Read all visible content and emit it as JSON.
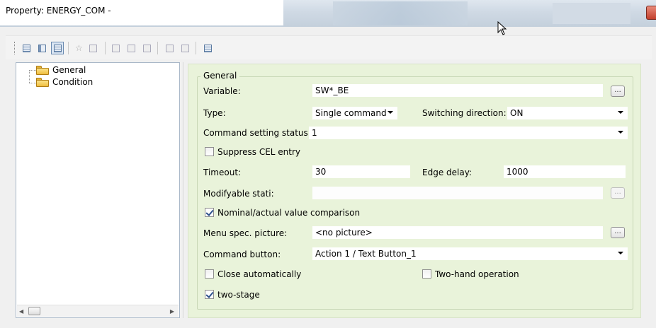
{
  "window": {
    "title": "Property: ENERGY_COM -"
  },
  "toolbar": {
    "buttons": [
      "view-list-icon",
      "view-details-icon",
      "view-properties-icon",
      "favorite-icon",
      "copy-icon",
      "grid-icon",
      "field-icon",
      "field2-icon",
      "layout-icon",
      "align-icon",
      "table-icon"
    ]
  },
  "tree": {
    "items": [
      {
        "label": "General",
        "icon": "folder-icon"
      },
      {
        "label": "Condition",
        "icon": "folder-icon"
      }
    ]
  },
  "general": {
    "group_title": "General",
    "variable_label": "Variable:",
    "variable_value": "SW*_BE",
    "type_label": "Type:",
    "type_value": "Single command",
    "switching_direction_label": "Switching direction:",
    "switching_direction_value": "ON",
    "command_setting_status_label": "Command setting status:",
    "command_setting_status_value": "1",
    "suppress_cel_label": "Suppress CEL entry",
    "suppress_cel_checked": false,
    "timeout_label": "Timeout:",
    "timeout_value": "30",
    "edge_delay_label": "Edge delay:",
    "edge_delay_value": "1000",
    "modifyable_stati_label": "Modifyable stati:",
    "modifyable_stati_value": "",
    "nominal_actual_label": "Nominal/actual value comparison",
    "nominal_actual_checked": true,
    "menu_spec_picture_label": "Menu spec. picture:",
    "menu_spec_picture_value": "<no picture>",
    "command_button_label": "Command button:",
    "command_button_value": "Action 1 / Text Button_1",
    "close_auto_label": "Close automatically",
    "close_auto_checked": false,
    "two_hand_label": "Two-hand operation",
    "two_hand_checked": false,
    "two_stage_label": "two-stage",
    "two_stage_checked": true,
    "ellipsis": "..."
  },
  "colors": {
    "panel_bg": "#e9f3da",
    "check_color": "#2a4e8a"
  }
}
